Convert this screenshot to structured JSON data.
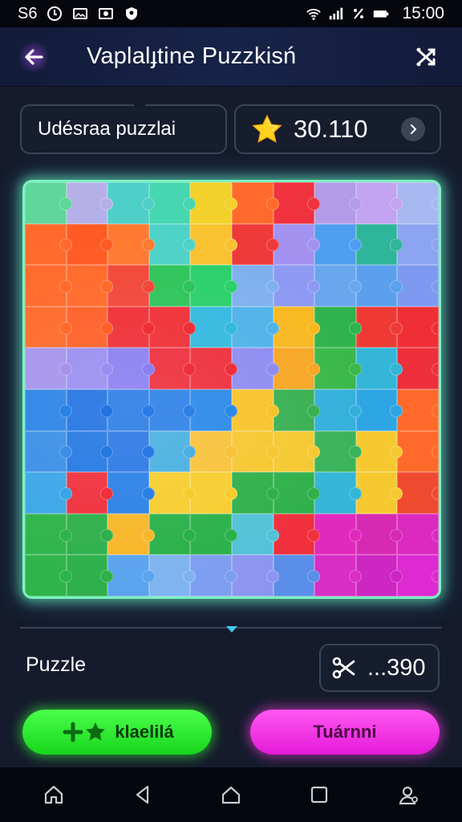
{
  "status_bar": {
    "carrier": "S6",
    "time": "15:00",
    "icons": [
      "alarm-icon",
      "photo-icon",
      "cast-icon",
      "shield-icon",
      "wifi-icon",
      "signal-icon",
      "percent-icon",
      "battery-icon"
    ]
  },
  "header": {
    "title": "Vaplalɟtine Puzzkisń",
    "back_icon": "arrow-left-icon",
    "action_icon": "shuffle-icon"
  },
  "info": {
    "puzzle_name": "Udésraa puzzlai",
    "score_icon": "star-icon",
    "score": "30.110"
  },
  "board": {
    "rows": 10,
    "cols": 10,
    "piece_colors": [
      [
        "#5fd69a",
        "#b6b0e8",
        "#4ed0c8",
        "#46d7b0",
        "#f2d12a",
        "#ff6a2a",
        "#f0323e",
        "#b49be8",
        "#c3a4f0",
        "#a6b8f0"
      ],
      [
        "#ff6a2a",
        "#ff5a24",
        "#ff7a30",
        "#4fd2c8",
        "#f8c230",
        "#ef3a3a",
        "#a392f0",
        "#4f9ff0",
        "#2fb59a",
        "#8da4f2"
      ],
      [
        "#ff6a2a",
        "#ff6a2a",
        "#f2473a",
        "#2fc45a",
        "#2ad06a",
        "#7fb0ef",
        "#8e9af2",
        "#6aa6ee",
        "#5ba0ee",
        "#7e9af0"
      ],
      [
        "#ff6a2a",
        "#ff6028",
        "#ef2f36",
        "#ef2f36",
        "#34b9e0",
        "#4fb2e8",
        "#f8b820",
        "#2fb34d",
        "#ef3a34",
        "#ef2f36"
      ],
      [
        "#a494ec",
        "#9a8ef0",
        "#8a7ff0",
        "#ee2f3c",
        "#ee2f3c",
        "#8e8cf0",
        "#f7a724",
        "#3ab84a",
        "#34b6d8",
        "#ee2f3c"
      ],
      [
        "#2a83e6",
        "#2273e2",
        "#2a7ce6",
        "#2d80e8",
        "#2a88e8",
        "#f8c32a",
        "#3ab052",
        "#34b0dc",
        "#2ea6e4",
        "#ff6a2a"
      ],
      [
        "#3a8ee8",
        "#2478e2",
        "#2a78e4",
        "#49b0e0",
        "#f8c23a",
        "#f6c730",
        "#f5c930",
        "#3ab45a",
        "#f6c930",
        "#ff6a2a"
      ],
      [
        "#39a6e6",
        "#f0303c",
        "#2b80e6",
        "#f7cd2e",
        "#f7cd2e",
        "#2fb04a",
        "#2fb04a",
        "#34b6d8",
        "#f6c930",
        "#f04a30"
      ],
      [
        "#2eb44a",
        "#2eb04a",
        "#f8b72a",
        "#2ab14a",
        "#2ab14a",
        "#53c2d8",
        "#f0303c",
        "#e02abd",
        "#d72ab4",
        "#dc2ac1"
      ],
      [
        "#2eb44a",
        "#2eb04a",
        "#5aa4ee",
        "#7fb4f0",
        "#7e9ef0",
        "#8c96f0",
        "#5a8ee8",
        "#d82ec6",
        "#cd26c2",
        "#dd2ad2"
      ]
    ]
  },
  "footer": {
    "puzzle_label": "Puzzle",
    "tools_icon": "scissors-icon",
    "tools_value": "...390",
    "hint_label": "klaelilá",
    "hint_icon": "plus-star-icon",
    "tournament_label": "Tuárnni"
  },
  "nav_bar": {
    "items": [
      "home-icon",
      "back-icon",
      "home-outline-icon",
      "recents-icon",
      "user-icon"
    ]
  },
  "colors": {
    "accent_green": "#2ee03a",
    "accent_magenta": "#f02ae6",
    "board_glow": "#7cf2c0"
  }
}
